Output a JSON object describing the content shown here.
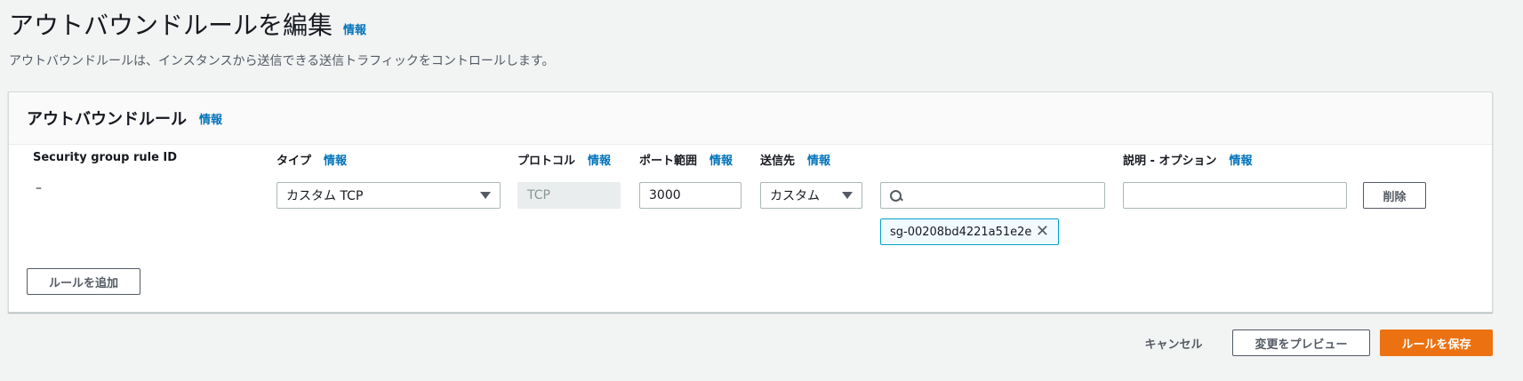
{
  "page": {
    "title": "アウトバウンドルールを編集",
    "title_info": "情報",
    "description": "アウトバウンドルールは、インスタンスから送信できる送信トラフィックをコントロールします。"
  },
  "panel": {
    "title": "アウトバウンドルール",
    "title_info": "情報",
    "columns": {
      "rule_id": "Security group rule ID",
      "type": "タイプ",
      "protocol": "プロトコル",
      "port_range": "ポート範囲",
      "destination": "送信先",
      "description": "説明 - オプション",
      "info": "情報"
    },
    "row": {
      "rule_id": "–",
      "type_value": "カスタム TCP",
      "protocol_value": "TCP",
      "port_value": "3000",
      "destination_type": "カスタム",
      "destination_search": "",
      "destination_token": "sg-00208bd4221a51e2e",
      "description_value": "",
      "delete_label": "削除"
    },
    "add_rule_label": "ルールを追加"
  },
  "footer": {
    "cancel_label": "キャンセル",
    "preview_label": "変更をプレビュー",
    "save_label": "ルールを保存"
  },
  "icons": {
    "dropdown": "chevron-down-icon",
    "search": "search-icon",
    "remove": "close-icon"
  },
  "colors": {
    "primary": "#ec7211",
    "link": "#0073bb",
    "token_border": "#00a1c9"
  }
}
